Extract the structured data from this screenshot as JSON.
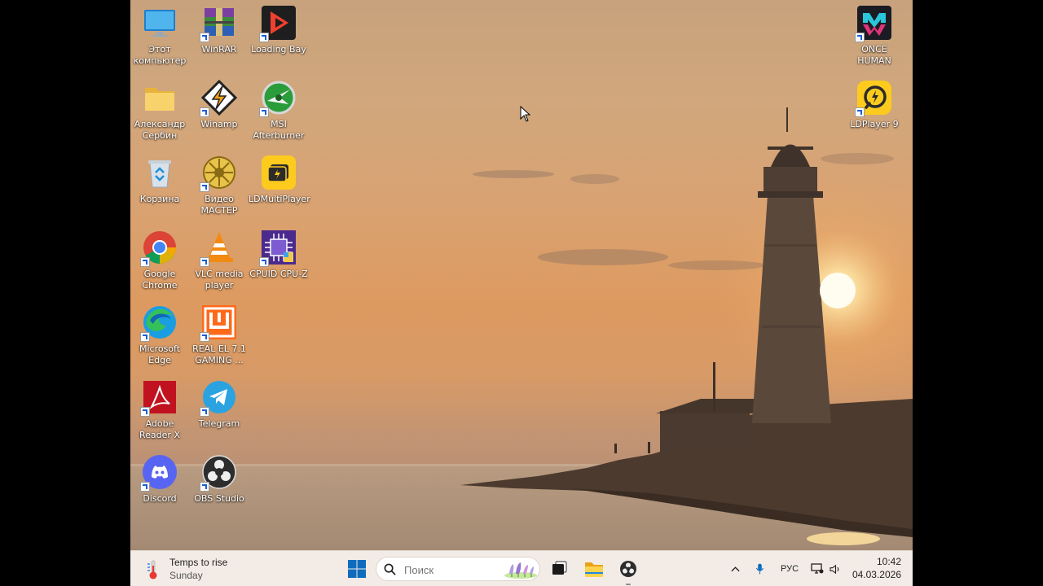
{
  "desktop": {
    "left_column": [
      {
        "label": "Этот компьютер",
        "icon": "monitor-icon"
      },
      {
        "label": "Александр Сербин",
        "icon": "folder-icon"
      },
      {
        "label": "Корзина",
        "icon": "recycle-bin-icon"
      },
      {
        "label": "Google Chrome",
        "icon": "chrome-icon"
      },
      {
        "label": "Microsoft Edge",
        "icon": "edge-icon"
      },
      {
        "label": "Adobe Reader X",
        "icon": "adobe-reader-icon"
      },
      {
        "label": "Discord",
        "icon": "discord-icon"
      }
    ],
    "middle_column": [
      {
        "label": "WinRAR",
        "icon": "winrar-icon"
      },
      {
        "label": "Winamp",
        "icon": "winamp-icon"
      },
      {
        "label": "Видео МАСТЕР",
        "icon": "video-master-icon"
      },
      {
        "label": "VLC media player",
        "icon": "vlc-icon"
      },
      {
        "label": "REAL EL 7.1 GAMING ...",
        "icon": "real-el-icon"
      },
      {
        "label": "Telegram",
        "icon": "telegram-icon"
      },
      {
        "label": "OBS Studio",
        "icon": "obs-icon"
      }
    ],
    "third_column": [
      {
        "label": "Loading Bay",
        "icon": "loading-bay-icon"
      },
      {
        "label": "MSI Afterburner",
        "icon": "msi-afterburner-icon"
      },
      {
        "label": "LDMultiPlayer",
        "icon": "ldmultiplayer-icon"
      },
      {
        "label": "CPUID CPU-Z",
        "icon": "cpuz-icon"
      }
    ],
    "right_column": [
      {
        "label": "ONCE HUMAN",
        "icon": "once-human-icon"
      },
      {
        "label": "LDPlayer 9",
        "icon": "ldplayer-icon"
      }
    ]
  },
  "taskbar": {
    "weather": {
      "title": "Temps to rise",
      "subtitle": "Sunday",
      "icon": "thermometer-icon"
    },
    "search": {
      "placeholder": "Поиск"
    },
    "pinned": [
      "windows-start-icon",
      "task-view-icon",
      "file-explorer-icon",
      "obs-taskbar-icon"
    ],
    "tray": {
      "language": "РУС",
      "time": "10:42",
      "date": "04.03.2026"
    }
  },
  "colors": {
    "taskbar_bg": "#f3ece6",
    "windows_blue": "#0f6cbd",
    "sky": "#d9a271"
  }
}
